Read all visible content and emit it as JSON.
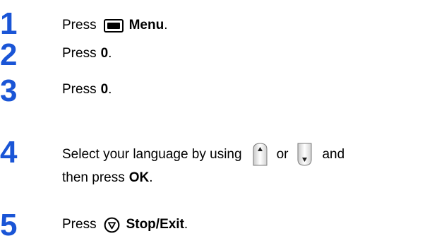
{
  "steps": [
    {
      "number": "1",
      "text_before": "Press",
      "button_label": "Menu",
      "text_after": ".",
      "icon": "menu-key-icon"
    },
    {
      "number": "2",
      "text_before": "Press",
      "key": "0",
      "text_after": "."
    },
    {
      "number": "3",
      "text_before": "Press",
      "key": "0",
      "text_after": "."
    },
    {
      "number": "4",
      "line1_before": "Select your language by using",
      "line1_or": "or",
      "line1_after": "and",
      "line2_before": "then press",
      "line2_button": "OK",
      "line2_after": ".",
      "icons": [
        "up-arrow-key-icon",
        "down-arrow-key-icon"
      ]
    },
    {
      "number": "5",
      "text_before": "Press",
      "button_label": "Stop/Exit",
      "text_after": ".",
      "icon": "stop-exit-icon"
    }
  ],
  "colors": {
    "step_number": "#1a55d6",
    "text": "#000000"
  }
}
